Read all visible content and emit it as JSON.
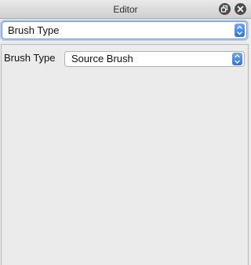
{
  "window": {
    "title": "Editor"
  },
  "panel_selector": {
    "value": "Brush Type"
  },
  "brush_type": {
    "label": "Brush Type",
    "value": "Source Brush"
  },
  "colors": {
    "accent": "#2d73df",
    "focus_ring": "#6a9bd8",
    "panel_bg": "#ececec"
  },
  "icons": {
    "float": "float-window-icon",
    "close": "close-icon",
    "stepper": "up-down-arrows-icon"
  }
}
